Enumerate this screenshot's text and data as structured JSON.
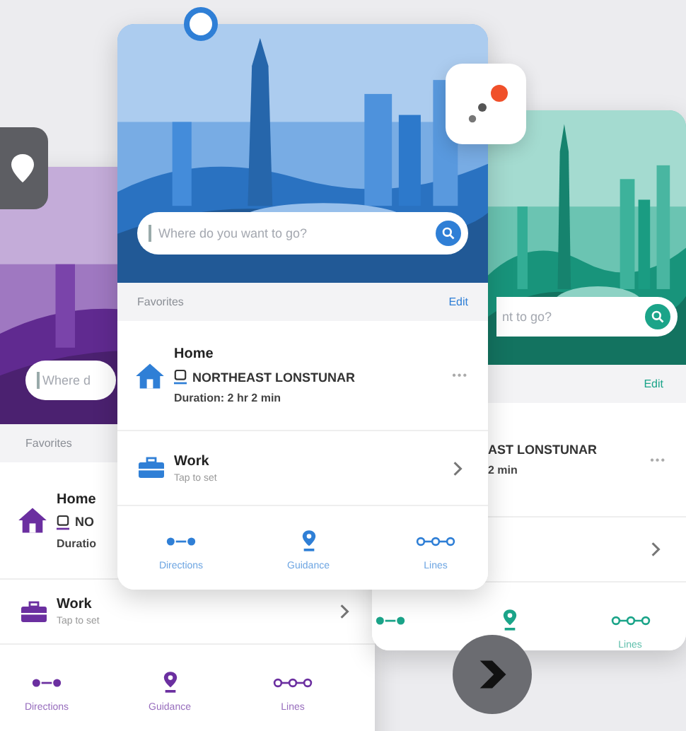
{
  "screens": [
    {
      "color": "#6b2fa0",
      "search": {
        "placeholder": "Where d"
      },
      "favorites": {
        "title": "Favorites"
      },
      "home": {
        "title": "Home",
        "route": "NO",
        "duration": "Duratio"
      },
      "work": {
        "title": "Work",
        "subtitle": "Tap to set"
      },
      "nav": [
        {
          "label": "Directions",
          "kind": "directions"
        },
        {
          "label": "Guidance",
          "kind": "guidance"
        },
        {
          "label": "Lines",
          "kind": "lines"
        }
      ]
    },
    {
      "color": "#1ba489",
      "search": {
        "placeholder": "nt to go?"
      },
      "favorites": {
        "edit": "Edit"
      },
      "home": {
        "route": "AST LONSTUNAR",
        "duration": "2 min",
        "more": "•••"
      },
      "nav": [
        {
          "kind": "directions"
        },
        {
          "kind": "guidance"
        },
        {
          "label": "Lines",
          "kind": "lines"
        }
      ]
    },
    {
      "color": "#2f7fd6",
      "search": {
        "placeholder": "Where do you want to go?"
      },
      "favorites": {
        "title": "Favorites",
        "edit": "Edit"
      },
      "home": {
        "title": "Home",
        "route": "NORTHEAST LONSTUNAR",
        "duration": "Duration: 2 hr 2 min",
        "more": "•••"
      },
      "work": {
        "title": "Work",
        "subtitle": "Tap to set"
      },
      "nav": [
        {
          "label": "Directions",
          "kind": "directions"
        },
        {
          "label": "Guidance",
          "kind": "guidance"
        },
        {
          "label": "Lines",
          "kind": "lines"
        }
      ]
    }
  ]
}
